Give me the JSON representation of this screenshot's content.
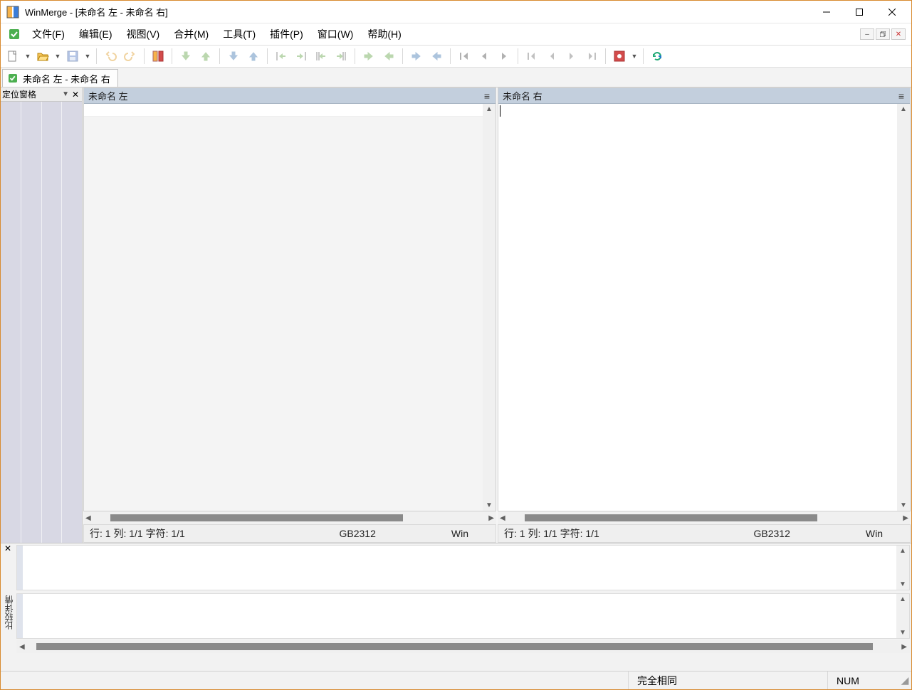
{
  "window": {
    "title": "WinMerge - [未命名 左 - 未命名 右]"
  },
  "menu": {
    "items": [
      "文件(F)",
      "编辑(E)",
      "视图(V)",
      "合并(M)",
      "工具(T)",
      "插件(P)",
      "窗口(W)",
      "帮助(H)"
    ]
  },
  "toolbar": {
    "buttons": [
      {
        "name": "new-icon",
        "disabled": false,
        "dd": true
      },
      {
        "name": "open-icon",
        "disabled": false,
        "dd": true
      },
      {
        "name": "save-icon",
        "disabled": true,
        "dd": true
      },
      {
        "sep": true
      },
      {
        "name": "undo-icon",
        "disabled": true
      },
      {
        "name": "redo-icon",
        "disabled": true
      },
      {
        "sep": true
      },
      {
        "name": "compare-icon",
        "disabled": false
      },
      {
        "sep": true
      },
      {
        "name": "diff-next-icon",
        "disabled": true
      },
      {
        "name": "diff-prev-icon",
        "disabled": true
      },
      {
        "sep": true
      },
      {
        "name": "diff-down-icon",
        "disabled": true
      },
      {
        "name": "diff-up-icon",
        "disabled": true
      },
      {
        "sep": true
      },
      {
        "name": "merge-left-icon",
        "disabled": true
      },
      {
        "name": "merge-right-icon",
        "disabled": true
      },
      {
        "name": "merge-left-all-icon",
        "disabled": true
      },
      {
        "name": "merge-right-all-icon",
        "disabled": true
      },
      {
        "sep": true
      },
      {
        "name": "arrow-right-icon",
        "disabled": true
      },
      {
        "name": "arrow-left-icon",
        "disabled": true
      },
      {
        "sep": true
      },
      {
        "name": "arrow-rr-icon",
        "disabled": true
      },
      {
        "name": "arrow-ll-icon",
        "disabled": true
      },
      {
        "sep": true
      },
      {
        "name": "first-icon",
        "disabled": true
      },
      {
        "name": "prev-page-icon",
        "disabled": true
      },
      {
        "name": "next-page-icon",
        "disabled": true
      },
      {
        "sep": true
      },
      {
        "name": "nav-first-icon",
        "disabled": true
      },
      {
        "name": "nav-prev-icon",
        "disabled": true
      },
      {
        "name": "nav-next-icon",
        "disabled": true
      },
      {
        "name": "nav-last-icon",
        "disabled": true
      },
      {
        "sep": true
      },
      {
        "name": "options-icon",
        "disabled": false,
        "dd": true
      },
      {
        "sep": true
      },
      {
        "name": "refresh-icon",
        "disabled": false
      }
    ]
  },
  "doctab": {
    "label": "未命名 左 - 未命名 右"
  },
  "location_pane": {
    "title": "定位窗格"
  },
  "panes": {
    "left": {
      "title": "未命名 左",
      "status_pos": "行: 1  列: 1/1  字符: 1/1",
      "encoding": "GB2312",
      "eol": "Win"
    },
    "right": {
      "title": "未命名 右",
      "status_pos": "行: 1  列: 1/1  字符: 1/1",
      "encoding": "GB2312",
      "eol": "Win"
    }
  },
  "diffpane": {
    "vlabel": "比较详情"
  },
  "statusbar": {
    "status": "完全相同",
    "num": "NUM"
  }
}
